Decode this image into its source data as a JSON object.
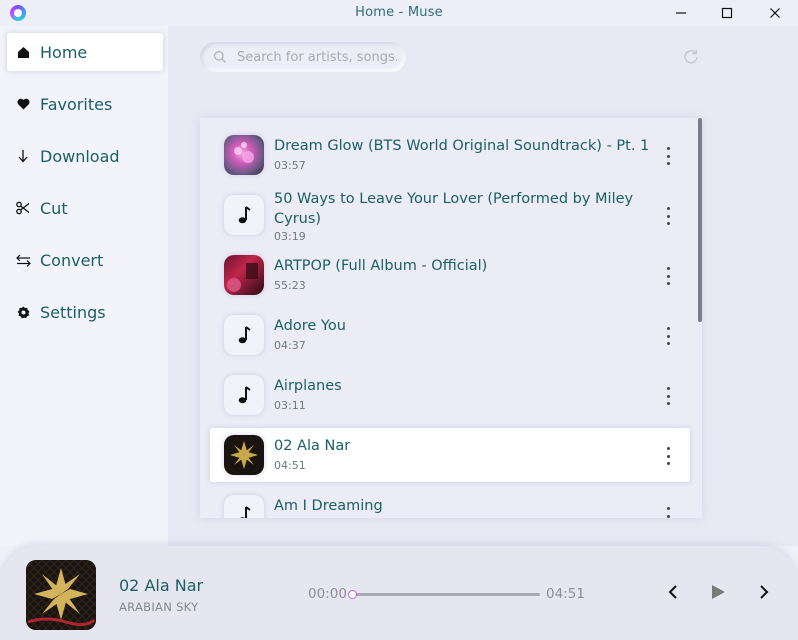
{
  "window": {
    "title": "Home - Muse",
    "minimize_label": "—",
    "maximize_label": "☐",
    "close_label": "✕"
  },
  "sidebar": {
    "items": [
      {
        "label": "Home",
        "icon": "home-icon"
      },
      {
        "label": "Favorites",
        "icon": "heart-icon"
      },
      {
        "label": "Download",
        "icon": "download-arrow-icon"
      },
      {
        "label": "Cut",
        "icon": "scissors-icon"
      },
      {
        "label": "Convert",
        "icon": "convert-arrows-icon"
      },
      {
        "label": "Settings",
        "icon": "gear-icon"
      }
    ],
    "active": "Home"
  },
  "search": {
    "placeholder": "Search for artists, songs...",
    "value": ""
  },
  "songs": [
    {
      "title": "Dream Glow (BTS World Original Soundtrack) - Pt. 1",
      "duration": "03:57",
      "art": "album-art"
    },
    {
      "title": "50 Ways to Leave Your Lover (Performed by Miley Cyrus)",
      "duration": "03:19",
      "art": "music-note-icon"
    },
    {
      "title": "ARTPOP (Full Album - Official)",
      "duration": "55:23",
      "art": "album-art"
    },
    {
      "title": "Adore You",
      "duration": "04:37",
      "art": "music-note-icon"
    },
    {
      "title": "Airplanes",
      "duration": "03:11",
      "art": "music-note-icon"
    },
    {
      "title": "02 Ala Nar",
      "duration": "04:51",
      "art": "album-art"
    },
    {
      "title": "Am I Dreaming",
      "duration": "",
      "art": "music-note-icon"
    }
  ],
  "selected_song": "02 Ala Nar",
  "player": {
    "title": "02 Ala Nar",
    "artist": "ARABIAN SKY",
    "current_time": "00:00",
    "total_time": "04:51",
    "progress": 0.0,
    "accent_color": "#c05fe0"
  },
  "colors": {
    "text_primary": "#1b5f66",
    "background": "#f1f1fa"
  }
}
